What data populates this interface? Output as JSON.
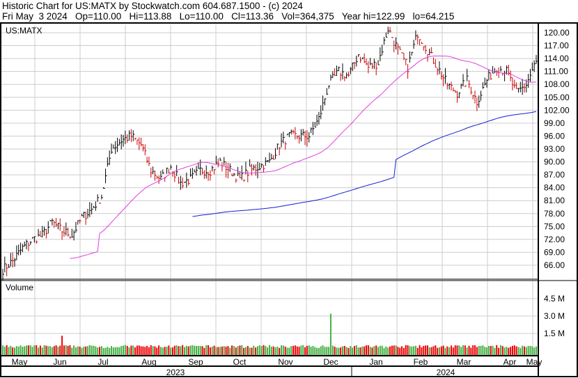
{
  "header": {
    "line1": "Historic Chart for US:MATX by Stockwatch.com 604.687.1500 - (c) 2024",
    "line2": "Fri May  3 2024   Op=110.00   Hi=113.88   Lo=110.00   Cl=113.36   Vol=364,375   Year hi=122.99   lo=64.215"
  },
  "chart_data": [
    {
      "type": "line",
      "title": "US:MATX",
      "subtype": "ohlc-bars with moving averages",
      "ylim": [
        63,
        123
      ],
      "y_ticks": [
        "120.00",
        "117.00",
        "114.00",
        "111.00",
        "108.00",
        "105.00",
        "102.00",
        "99.00",
        "96.00",
        "93.00",
        "90.00",
        "87.00",
        "84.00",
        "81.00",
        "78.00",
        "75.00",
        "72.00",
        "69.00",
        "66.00"
      ],
      "x_ticks": [
        "May",
        "Jun",
        "Jul",
        "Aug",
        "Sep",
        "Oct",
        "Nov",
        "Dec",
        "Jan",
        "Feb",
        "Mar",
        "Apr",
        "May"
      ],
      "years": [
        "2023",
        "2024"
      ],
      "weekly_close": [
        65,
        67,
        70,
        72,
        73,
        76,
        74,
        73,
        77,
        79,
        82,
        93,
        95,
        96,
        94,
        88,
        86,
        89,
        85,
        86,
        88,
        88,
        90,
        88,
        86,
        88,
        89,
        90,
        94,
        96,
        96,
        96,
        100,
        108,
        111,
        110,
        115,
        112,
        113,
        121,
        116,
        112,
        120,
        116,
        112,
        108,
        106,
        109,
        104,
        109,
        112,
        111,
        106,
        108,
        113.36
      ],
      "series": [
        {
          "name": "50-day MA",
          "color": "#e040e0"
        },
        {
          "name": "200-day MA",
          "color": "#1020d0"
        }
      ],
      "up_color": "#000000",
      "down_color": "#cc0000"
    },
    {
      "type": "bar",
      "title": "Volume",
      "y_ticks": [
        "4.5 M",
        "3.0 M",
        "1.5 M"
      ],
      "ylim": [
        0,
        6000000
      ],
      "spikes_millions": [
        {
          "month": "Jun",
          "value": 1.3
        },
        {
          "month": "Dec",
          "value": 3.2
        }
      ],
      "up_color": "#44b044",
      "down_color": "#ee0000"
    }
  ]
}
